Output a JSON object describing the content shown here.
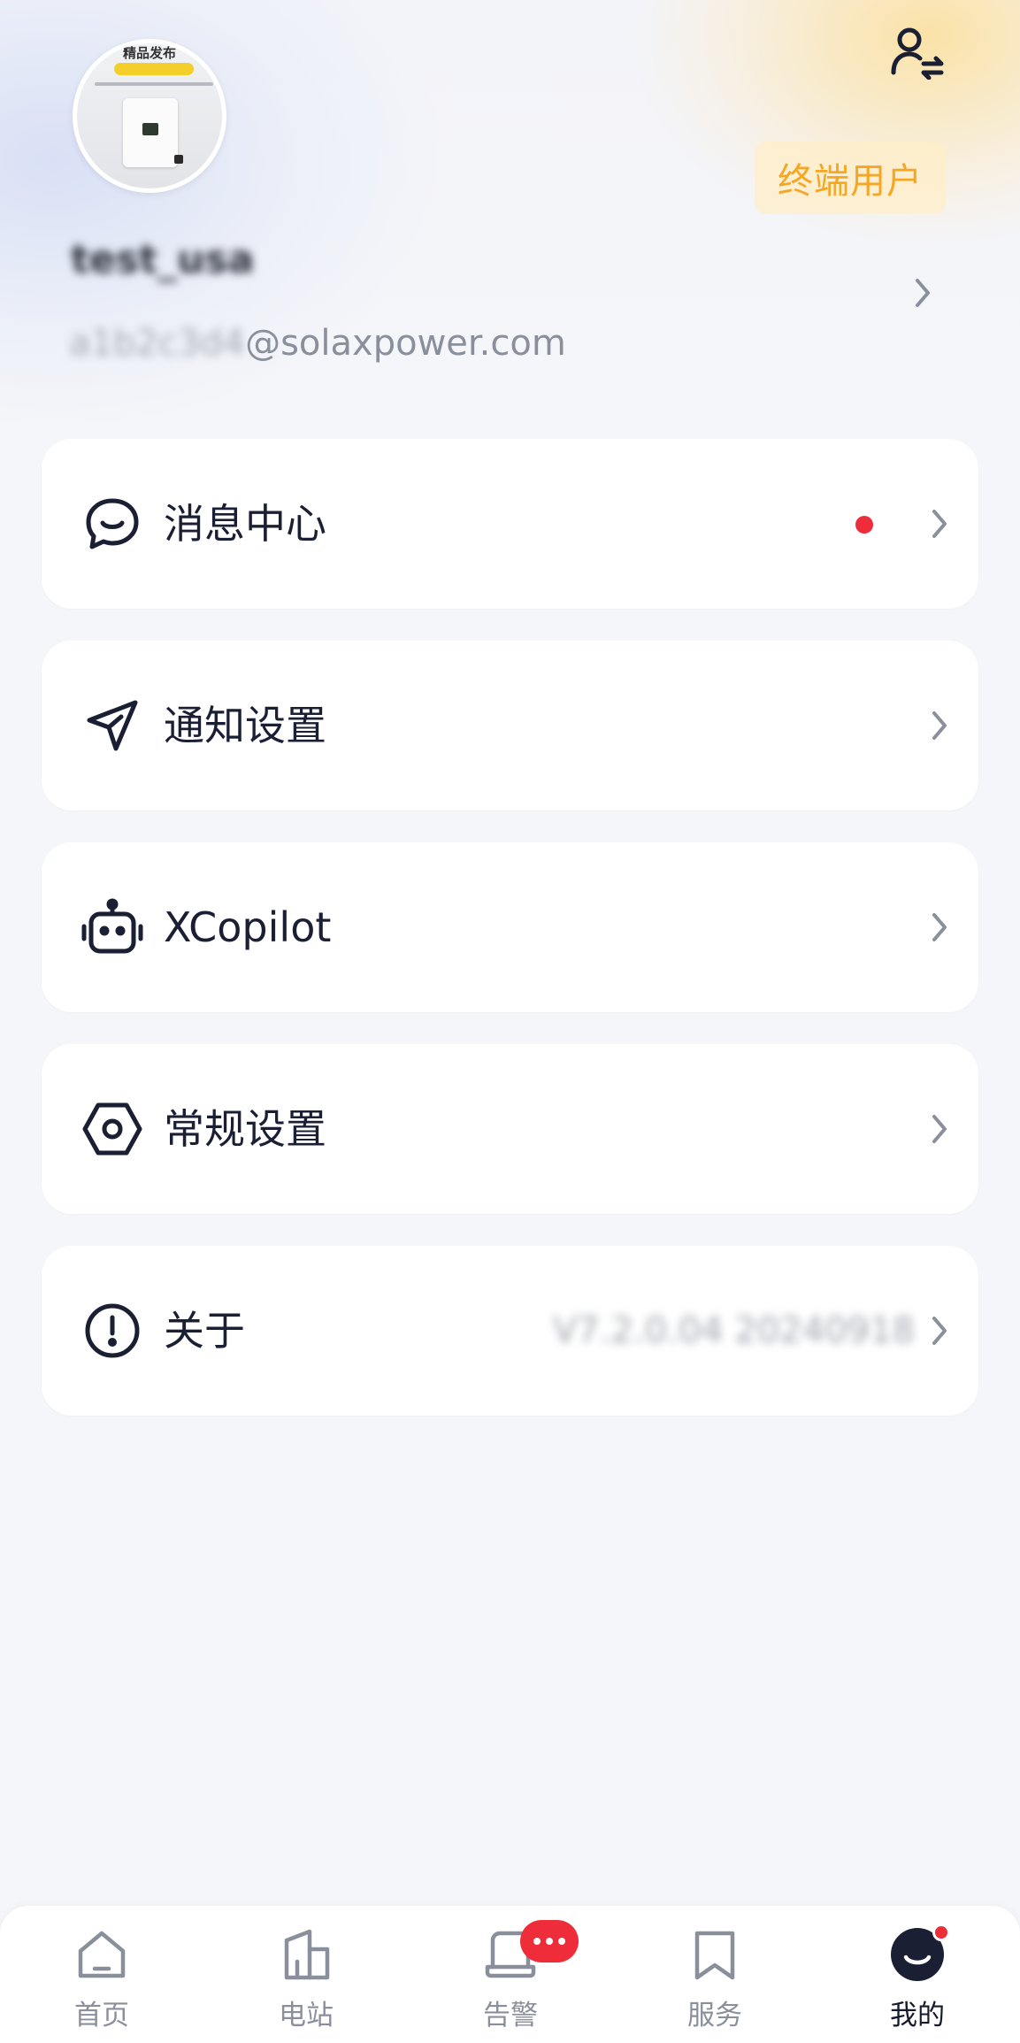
{
  "profile": {
    "avatar_text": "精品发布",
    "username": "test_usa",
    "email_masked": "a1b2c3d4",
    "email_domain": "@solaxpower.com",
    "role_badge": "终端用户"
  },
  "menu": {
    "items": [
      {
        "label": "消息中心",
        "icon": "chat-bubble-icon",
        "unread": true
      },
      {
        "label": "通知设置",
        "icon": "paper-plane-icon"
      },
      {
        "label": "XCopilot",
        "icon": "robot-icon"
      },
      {
        "label": "常规设置",
        "icon": "hexagon-gear-icon"
      },
      {
        "label": "关于",
        "icon": "exclamation-circle-icon",
        "value": "V7.2.0.04 20240918"
      }
    ]
  },
  "tabbar": {
    "items": [
      {
        "label": "首页",
        "icon": "home-icon"
      },
      {
        "label": "电站",
        "icon": "power-station-icon"
      },
      {
        "label": "告警",
        "icon": "alarm-icon",
        "badge": "..."
      },
      {
        "label": "服务",
        "icon": "bookmark-icon"
      },
      {
        "label": "我的",
        "icon": "smile-avatar-icon",
        "active": true
      }
    ]
  },
  "colors": {
    "accent_orange": "#f5a623",
    "alert_red": "#ef2d3a",
    "text_dark": "#1a1f33",
    "text_gray": "#8a8f9c"
  }
}
